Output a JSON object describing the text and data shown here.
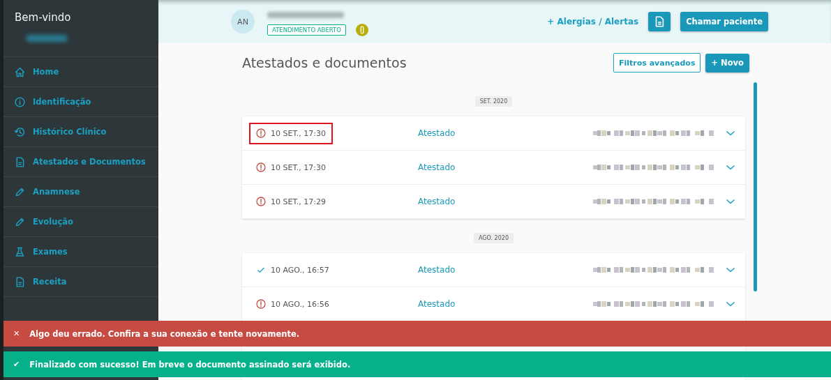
{
  "sidebar": {
    "title": "Bem-vindo",
    "items": [
      {
        "label": "Home",
        "kind": "home"
      },
      {
        "label": "Identificação",
        "kind": "info"
      },
      {
        "label": "Histórico Clínico",
        "kind": "history"
      },
      {
        "label": "Atestados e Documentos",
        "kind": "document"
      },
      {
        "label": "Anamnese",
        "kind": "pencil"
      },
      {
        "label": "Evolução",
        "kind": "pencil"
      },
      {
        "label": "Exames",
        "kind": "flask"
      },
      {
        "label": "Receita",
        "kind": "document"
      }
    ]
  },
  "header": {
    "avatar": "AN",
    "status_badge": "ATENDIMENTO ABERTO",
    "allergies_link": "+ Alergias / Alertas",
    "call_button": "Chamar paciente"
  },
  "page": {
    "title": "Atestados e documentos",
    "filter_button": "Filtros avançados",
    "new_button": "+ Novo"
  },
  "groups": [
    {
      "month": "SET. 2020",
      "rows": [
        {
          "date": "10 SET., 17:30",
          "type": "Atestado",
          "kind": "error",
          "highlighted": true
        },
        {
          "date": "10 SET., 17:30",
          "type": "Atestado",
          "kind": "error",
          "highlighted": false
        },
        {
          "date": "10 SET., 17:29",
          "type": "Atestado",
          "kind": "error",
          "highlighted": false
        }
      ]
    },
    {
      "month": "AGO. 2020",
      "rows": [
        {
          "date": "10 AGO., 16:57",
          "type": "Atestado",
          "kind": "done",
          "highlighted": false
        },
        {
          "date": "10 AGO., 16:56",
          "type": "Atestado",
          "kind": "error",
          "highlighted": false
        }
      ]
    }
  ],
  "toasts": [
    {
      "kind": "error",
      "icon": "✕",
      "message": "Algo deu errado. Confira a sua conexão e tente novamente."
    },
    {
      "kind": "success",
      "icon": "✔",
      "message": "Finalizado com sucesso! Em breve o documento assinado será exibido."
    }
  ]
}
